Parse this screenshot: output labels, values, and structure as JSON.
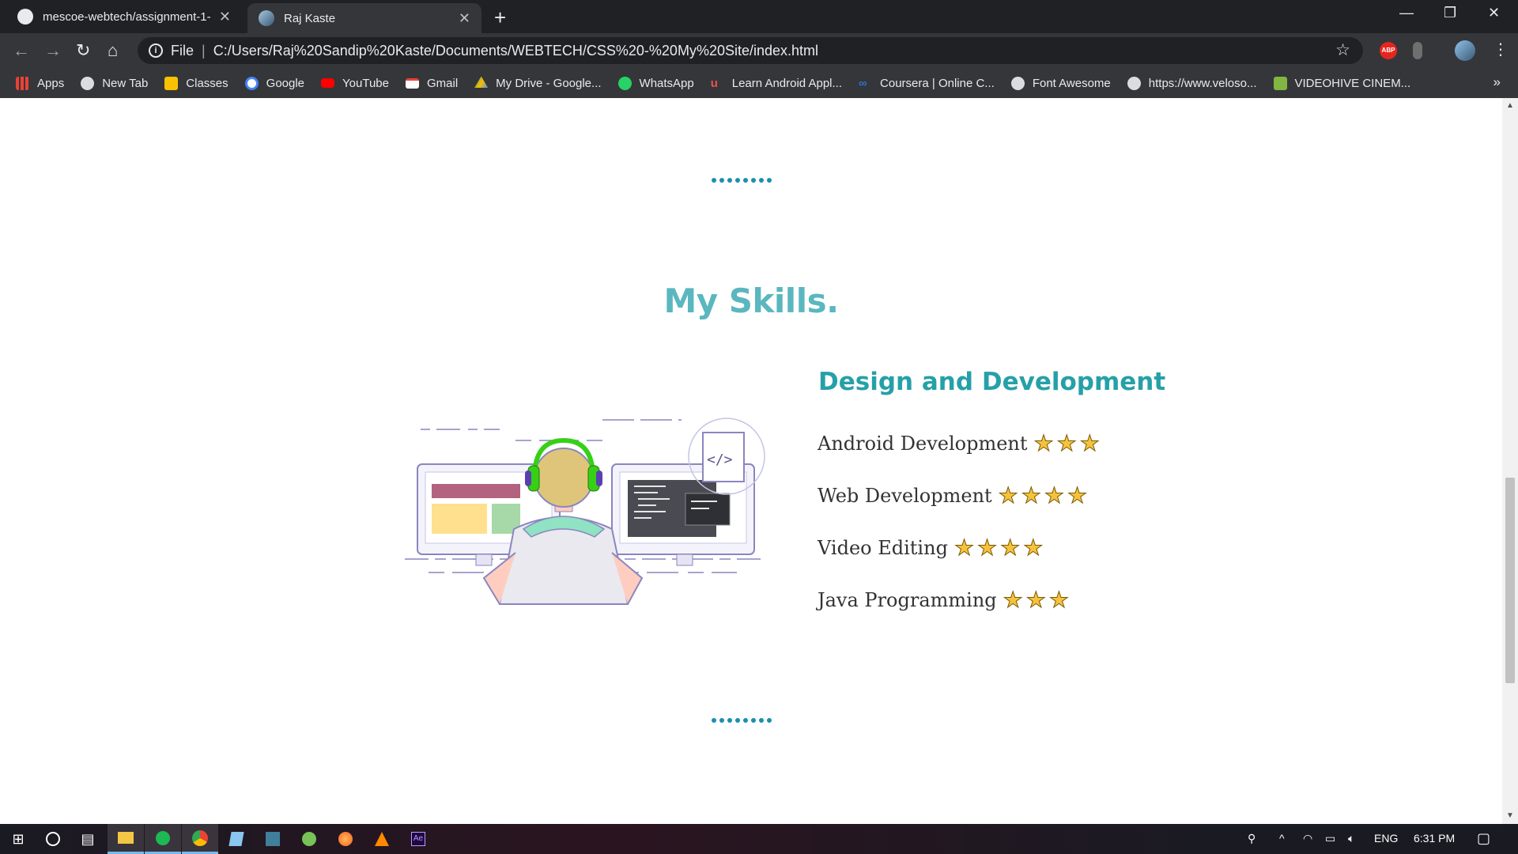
{
  "browser": {
    "tabs": [
      {
        "label": "mescoe-webtech/assignment-1-",
        "active": false
      },
      {
        "label": "Raj Kaste",
        "active": true
      }
    ],
    "address": {
      "scheme_label": "File",
      "url": "C:/Users/Raj%20Sandip%20Kaste/Documents/WEBTECH/CSS%20-%20My%20Site/index.html"
    },
    "extensions": {
      "abp": "ABP"
    },
    "bookmarks": [
      {
        "label": "Apps",
        "icon": "apps-grid-icon",
        "color": "#e94235"
      },
      {
        "label": "New Tab",
        "icon": "globe-icon",
        "color": "#dadce0"
      },
      {
        "label": "Classes",
        "icon": "classroom-icon",
        "color": "#f7c200"
      },
      {
        "label": "Google",
        "icon": "google-icon",
        "color": "#ffffff"
      },
      {
        "label": "YouTube",
        "icon": "youtube-icon",
        "color": "#ff0000"
      },
      {
        "label": "Gmail",
        "icon": "gmail-icon",
        "color": "#ea4335"
      },
      {
        "label": "My Drive - Google...",
        "icon": "drive-icon",
        "color": "#34a853"
      },
      {
        "label": "WhatsApp",
        "icon": "whatsapp-icon",
        "color": "#25d366"
      },
      {
        "label": "Learn Android Appl...",
        "icon": "udemy-icon",
        "color": "#ec5252"
      },
      {
        "label": "Coursera | Online C...",
        "icon": "coursera-icon",
        "color": "#2a73cc"
      },
      {
        "label": "Font Awesome",
        "icon": "globe-icon",
        "color": "#dadce0"
      },
      {
        "label": "https://www.veloso...",
        "icon": "globe-icon",
        "color": "#dadce0"
      },
      {
        "label": "VIDEOHIVE CINEM...",
        "icon": "envato-icon",
        "color": "#82b541"
      }
    ],
    "bookmarks_overflow": "»"
  },
  "page": {
    "skills_title": "My Skills.",
    "section_title": "Design and Development",
    "skills": [
      {
        "name": "Android Development",
        "stars": 3
      },
      {
        "name": "Web Development",
        "stars": 4
      },
      {
        "name": "Video Editing",
        "stars": 4
      },
      {
        "name": "Java Programming",
        "stars": 3
      }
    ],
    "colors": {
      "title": "#5ab7bf",
      "subtitle": "#26a0a8",
      "dots": "#1a8fb1",
      "star": "#f6c23e"
    }
  },
  "taskbar": {
    "apps": [
      "windows-start-icon",
      "cortana-icon",
      "task-view-icon",
      "file-explorer-icon",
      "spotify-icon",
      "chrome-icon",
      "notepad-icon",
      "visual-studio-icon",
      "android-studio-icon",
      "firefox-icon",
      "vlc-icon",
      "after-effects-icon"
    ],
    "after_effects_label": "Ae",
    "language": "ENG",
    "time": "6:31 PM"
  }
}
